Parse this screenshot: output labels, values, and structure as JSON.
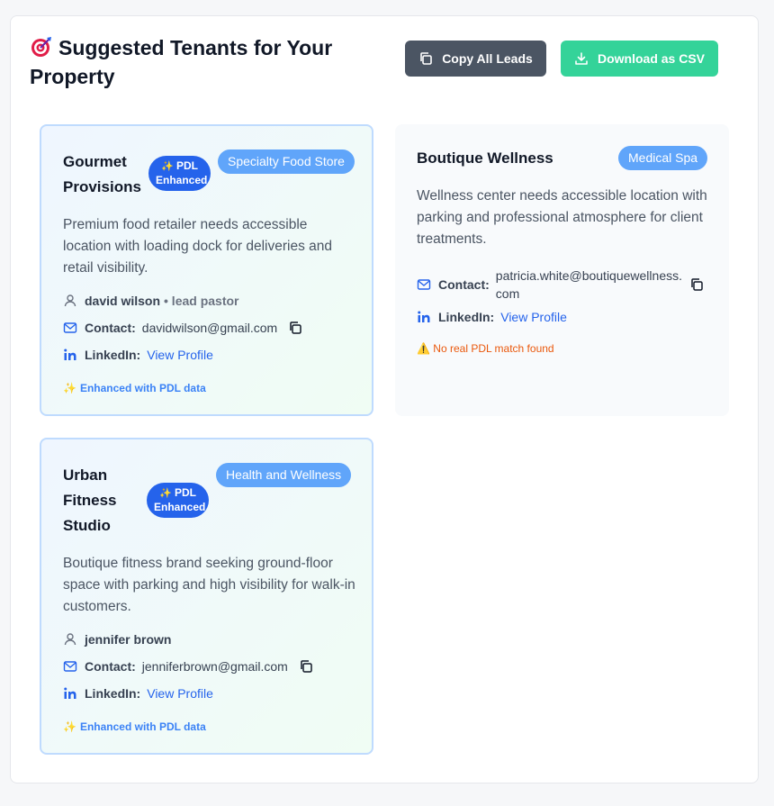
{
  "header": {
    "title": "Suggested Tenants for Your Property",
    "copy_button": "Copy All Leads",
    "csv_button": "Download as CSV"
  },
  "labels": {
    "contact": "Contact:",
    "linkedin": "LinkedIn:",
    "view_profile": "View Profile",
    "pdl_line1": "PDL",
    "pdl_line2": "Enhanced",
    "enhanced_note": "Enhanced with PDL data",
    "no_match": "No real PDL match found"
  },
  "tenants": [
    {
      "name": "Gourmet Provisions",
      "category": "Specialty Food Store",
      "description": "Premium food retailer needs accessible location with loading dock for deliveries and retail visibility.",
      "person": "david wilson",
      "role": "• lead pastor",
      "email": "davidwilson@gmail.com"
    },
    {
      "name": "Boutique Wellness",
      "category": "Medical Spa",
      "description": "Wellness center needs accessible location with parking and professional atmosphere for client treatments.",
      "email_line1": "patricia.white@boutiquewellness.",
      "email_line2": "com"
    },
    {
      "name": "Urban Fitness Studio",
      "category": "Health and Wellness",
      "description": "Boutique fitness brand seeking ground-floor space with parking and high visibility for walk-in customers.",
      "person": "jennifer brown",
      "email": "jenniferbrown@gmail.com"
    }
  ],
  "colors": {
    "accent_blue": "#2563eb",
    "badge_blue": "#60a5fa",
    "csv_green": "#34d399",
    "copy_gray": "#4b5563",
    "warning_orange": "#ea580c"
  }
}
